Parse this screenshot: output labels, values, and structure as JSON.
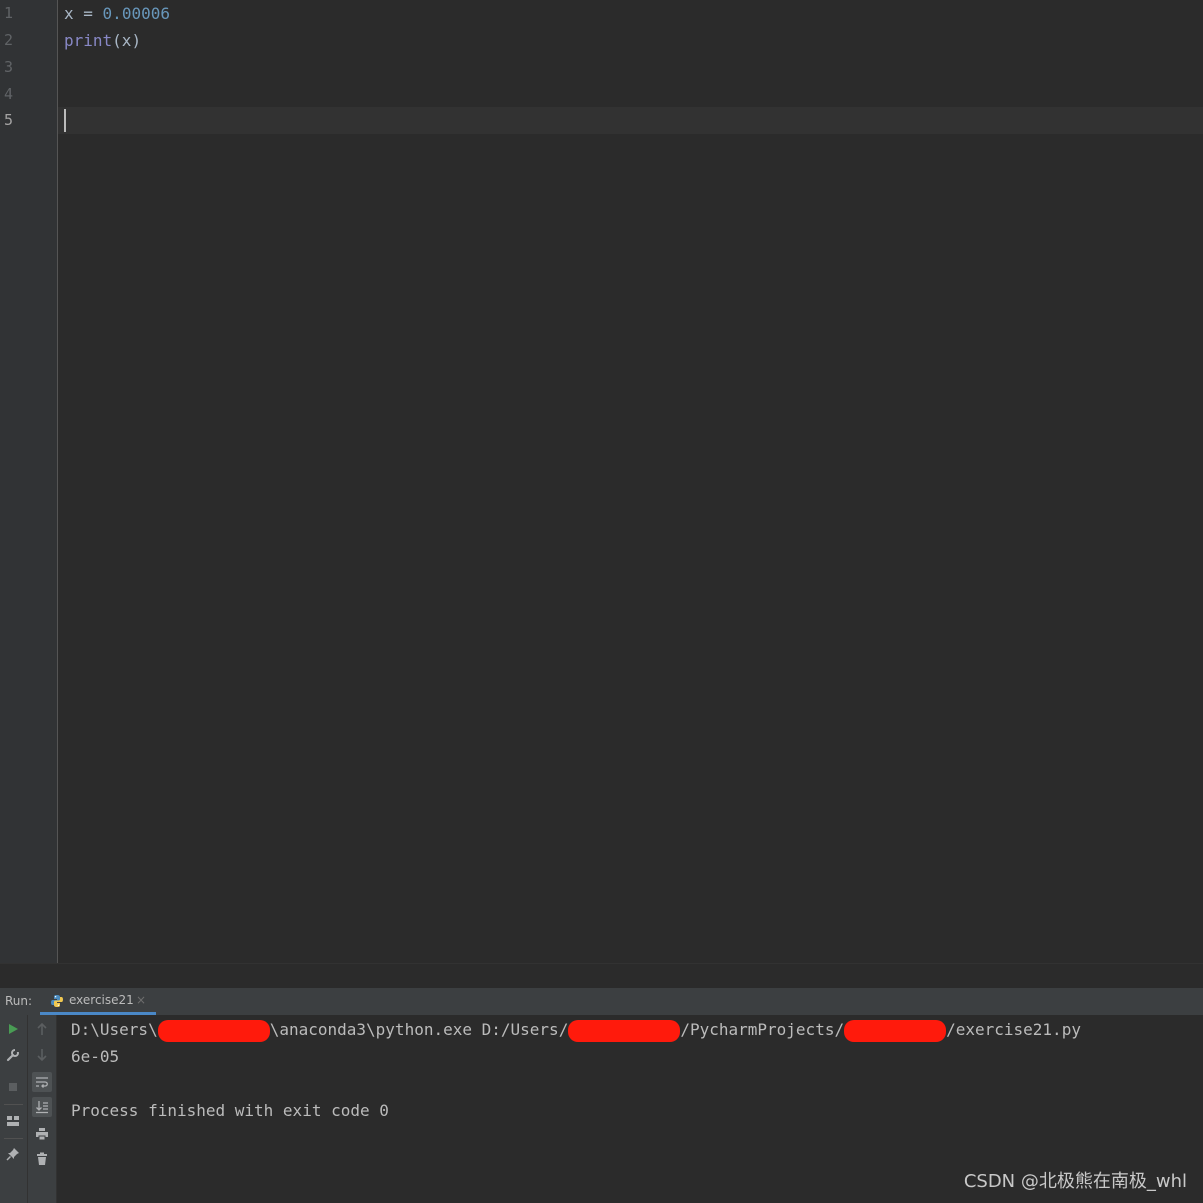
{
  "editor": {
    "line_numbers": [
      "1",
      "2",
      "3",
      "4",
      "5"
    ],
    "current_line": "5",
    "code": {
      "line1_var": "x",
      "line1_op": " = ",
      "line1_num": "0.00006",
      "line2_fn": "print",
      "line2_args": "(x)"
    }
  },
  "run_panel": {
    "label": "Run:",
    "tab_label": "exercise21",
    "tab_close": "×",
    "console": {
      "cmd_part1": "D:\\Users\\",
      "cmd_part2": "\\anaconda3\\python.exe D:/Users/",
      "cmd_part3": "/PycharmProjects/",
      "cmd_part4": "/exercise21.py",
      "output": "6e-05",
      "exit_message": "Process finished with exit code 0"
    },
    "toolbar_icons": {
      "left": [
        "run-icon",
        "wrench-icon",
        "stop-icon",
        "layout-icon",
        "pin-icon"
      ],
      "right": [
        "up-arrow-icon",
        "down-arrow-icon",
        "soft-wrap-icon",
        "scroll-to-end-icon",
        "print-icon",
        "trash-icon"
      ]
    }
  },
  "watermark": "CSDN @北极熊在南极_whl",
  "colors": {
    "background": "#2b2b2b",
    "gutter": "#313335",
    "number": "#6897bb",
    "builtin": "#8888c6",
    "run_icon": "#499c54",
    "redaction": "#ff1a0c",
    "tab_underline": "#4a88c7"
  }
}
